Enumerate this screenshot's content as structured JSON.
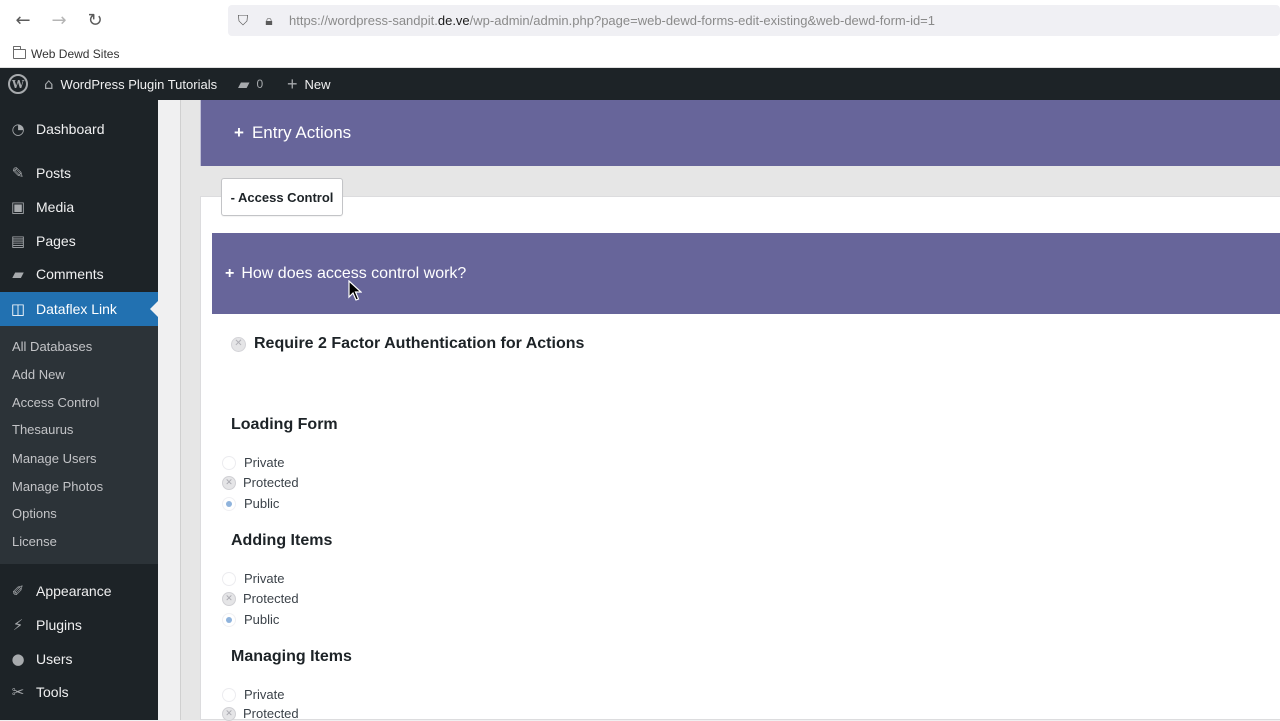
{
  "browser": {
    "url_pre": "https://wordpress-sandpit.",
    "url_host": "de.ve",
    "url_post": "/wp-admin/admin.php?page=web-dewd-forms-edit-existing&web-dewd-form-id=1",
    "bookmark_folder": "Web Dewd Sites"
  },
  "adminbar": {
    "site_name": "WordPress Plugin Tutorials",
    "comments_count": "0",
    "new_label": "New"
  },
  "sidebar": {
    "items": [
      {
        "label": "Dashboard",
        "icon": "dashboard-icon"
      },
      {
        "label": "Posts",
        "icon": "pin-icon"
      },
      {
        "label": "Media",
        "icon": "media-icon"
      },
      {
        "label": "Pages",
        "icon": "pages-icon"
      },
      {
        "label": "Comments",
        "icon": "comment-icon"
      },
      {
        "label": "Dataflex Link",
        "icon": "dataflex-icon"
      },
      {
        "label": "Appearance",
        "icon": "brush-icon"
      },
      {
        "label": "Plugins",
        "icon": "plugin-icon"
      },
      {
        "label": "Users",
        "icon": "user-icon"
      },
      {
        "label": "Tools",
        "icon": "wrench-icon"
      }
    ],
    "submenu": [
      "All Databases",
      "Add New",
      "Access Control",
      "Thesaurus",
      "Manage Users",
      "Manage Photos",
      "Options",
      "License"
    ]
  },
  "main": {
    "entry_actions": "Entry Actions",
    "tab_label": "- Access Control",
    "how_label": "How does access control work?",
    "plus": "+",
    "require_2fa": "Require 2 Factor Authentication for Actions",
    "sections": [
      {
        "title": "Loading Form",
        "options": [
          "Private",
          "Protected",
          "Public"
        ]
      },
      {
        "title": "Adding Items",
        "options": [
          "Private",
          "Protected",
          "Public"
        ]
      },
      {
        "title": "Managing Items",
        "options": [
          "Private",
          "Protected"
        ]
      }
    ]
  }
}
